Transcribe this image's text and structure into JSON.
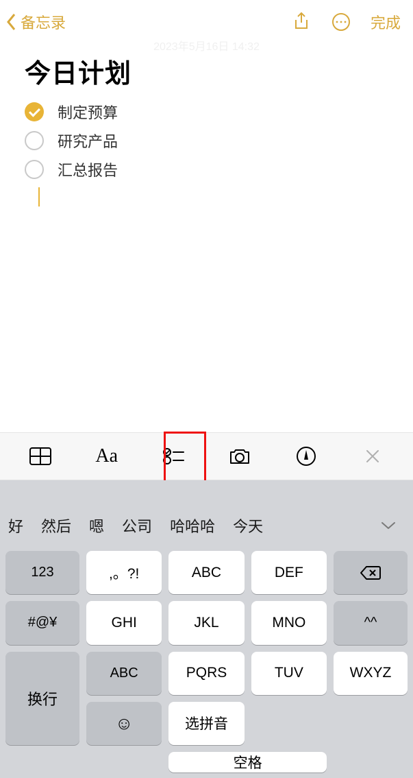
{
  "header": {
    "back_label": "备忘录",
    "done_label": "完成"
  },
  "watermark": "2023年5月16日 14:32",
  "note": {
    "title": "今日计划",
    "items": [
      {
        "text": "制定预算",
        "checked": true
      },
      {
        "text": "研究产品",
        "checked": false
      },
      {
        "text": "汇总报告",
        "checked": false
      }
    ]
  },
  "format_bar": {
    "icons": [
      "table",
      "text-format",
      "checklist",
      "camera",
      "markup",
      "close"
    ]
  },
  "candidates": [
    "好",
    "然后",
    "嗯",
    "公司",
    "哈哈哈",
    "今天"
  ],
  "keyboard": {
    "rows": [
      [
        "123",
        ",。?!",
        "ABC",
        "DEF",
        "backspace"
      ],
      [
        "#@¥",
        "GHI",
        "JKL",
        "MNO",
        "^^"
      ],
      [
        "ABC",
        "PQRS",
        "TUV",
        "WXYZ",
        "换行"
      ],
      [
        "emoji",
        "选拼音",
        "空格"
      ]
    ]
  }
}
